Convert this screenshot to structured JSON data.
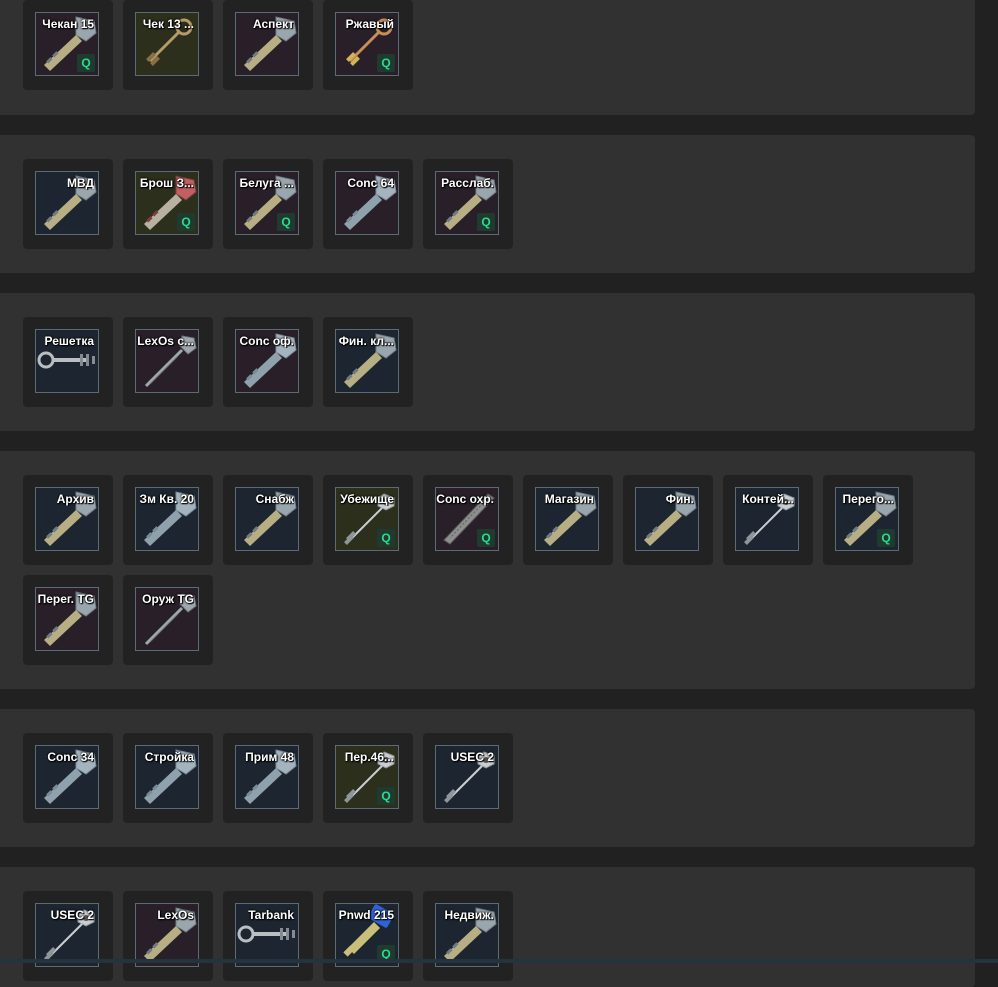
{
  "colors": {
    "page_bg": "#212121",
    "group_bg": "#313131",
    "tile_bg": "#222222",
    "badge_text": "#2ddc8f",
    "badge_bg": "#1f3a2e"
  },
  "groups": [
    {
      "items": [
        {
          "label": "Чекан 15",
          "bg": "purple",
          "key": "grey",
          "quest": true
        },
        {
          "label": "Чек 13 ...",
          "bg": "olive",
          "key": "bronze",
          "quest": false
        },
        {
          "label": "Аспект",
          "bg": "purple",
          "key": "grey",
          "quest": false
        },
        {
          "label": "Ржавый",
          "bg": "purple",
          "key": "rusty",
          "quest": true
        }
      ]
    },
    {
      "items": [
        {
          "label": "МВД",
          "bg": "navy",
          "key": "grey",
          "quest": false
        },
        {
          "label": "Брош З...",
          "bg": "olive",
          "key": "red",
          "quest": true
        },
        {
          "label": "Белуга ...",
          "bg": "purple",
          "key": "grey",
          "quest": true
        },
        {
          "label": "Conc 64",
          "bg": "purple",
          "key": "grey-blue",
          "quest": false
        },
        {
          "label": "Расслаб.",
          "bg": "purple",
          "key": "grey",
          "quest": true
        }
      ]
    },
    {
      "items": [
        {
          "label": "Решетка",
          "bg": "navy",
          "key": "long",
          "quest": false
        },
        {
          "label": "LexOs c...",
          "bg": "purple",
          "key": "slim",
          "quest": false
        },
        {
          "label": "Conc оф.",
          "bg": "purple",
          "key": "grey-blue",
          "quest": false
        },
        {
          "label": "Фин. кл...",
          "bg": "navy",
          "key": "grey",
          "quest": false
        }
      ]
    },
    {
      "items": [
        {
          "label": "Архив",
          "bg": "navy",
          "key": "grey",
          "quest": false
        },
        {
          "label": "Зм Кв. 20",
          "bg": "navy",
          "key": "grey-blue",
          "quest": false
        },
        {
          "label": "Снабж",
          "bg": "navy",
          "key": "grey",
          "quest": false
        },
        {
          "label": "Убежище",
          "bg": "olive",
          "key": "pin",
          "quest": true
        },
        {
          "label": "Conc охр.",
          "bg": "purple",
          "key": "blade",
          "quest": true
        },
        {
          "label": "Магазин",
          "bg": "navy",
          "key": "grey",
          "quest": false
        },
        {
          "label": "Фин.",
          "bg": "navy",
          "key": "grey",
          "quest": false
        },
        {
          "label": "Контей...",
          "bg": "navy",
          "key": "pin",
          "quest": false
        },
        {
          "label": "Перего...",
          "bg": "navy",
          "key": "grey",
          "quest": true
        },
        {
          "label": "Перег. TG",
          "bg": "purple",
          "key": "grey",
          "quest": false
        },
        {
          "label": "Оруж TG",
          "bg": "purple",
          "key": "slim",
          "quest": false
        }
      ]
    },
    {
      "items": [
        {
          "label": "Conc 34",
          "bg": "navy",
          "key": "grey-blue",
          "quest": false
        },
        {
          "label": "Стройка",
          "bg": "navy",
          "key": "grey-blue",
          "quest": false
        },
        {
          "label": "Прим 48",
          "bg": "navy",
          "key": "grey-blue",
          "quest": false
        },
        {
          "label": "Пер.46...",
          "bg": "olive",
          "key": "pin",
          "quest": true
        },
        {
          "label": "USEC 2",
          "bg": "navy",
          "key": "pin",
          "quest": false
        }
      ]
    },
    {
      "items": [
        {
          "label": "USEC 2",
          "bg": "navy",
          "key": "pin",
          "quest": false
        },
        {
          "label": "LexOs",
          "bg": "purple",
          "key": "grey",
          "quest": false
        },
        {
          "label": "Tarbank",
          "bg": "navy",
          "key": "long",
          "quest": false
        },
        {
          "label": "Pnwd 215",
          "bg": "navy",
          "key": "blue-head",
          "quest": true
        },
        {
          "label": "Недвиж.",
          "bg": "navy",
          "key": "grey",
          "quest": false
        }
      ]
    }
  ],
  "quest_badge": "Q"
}
